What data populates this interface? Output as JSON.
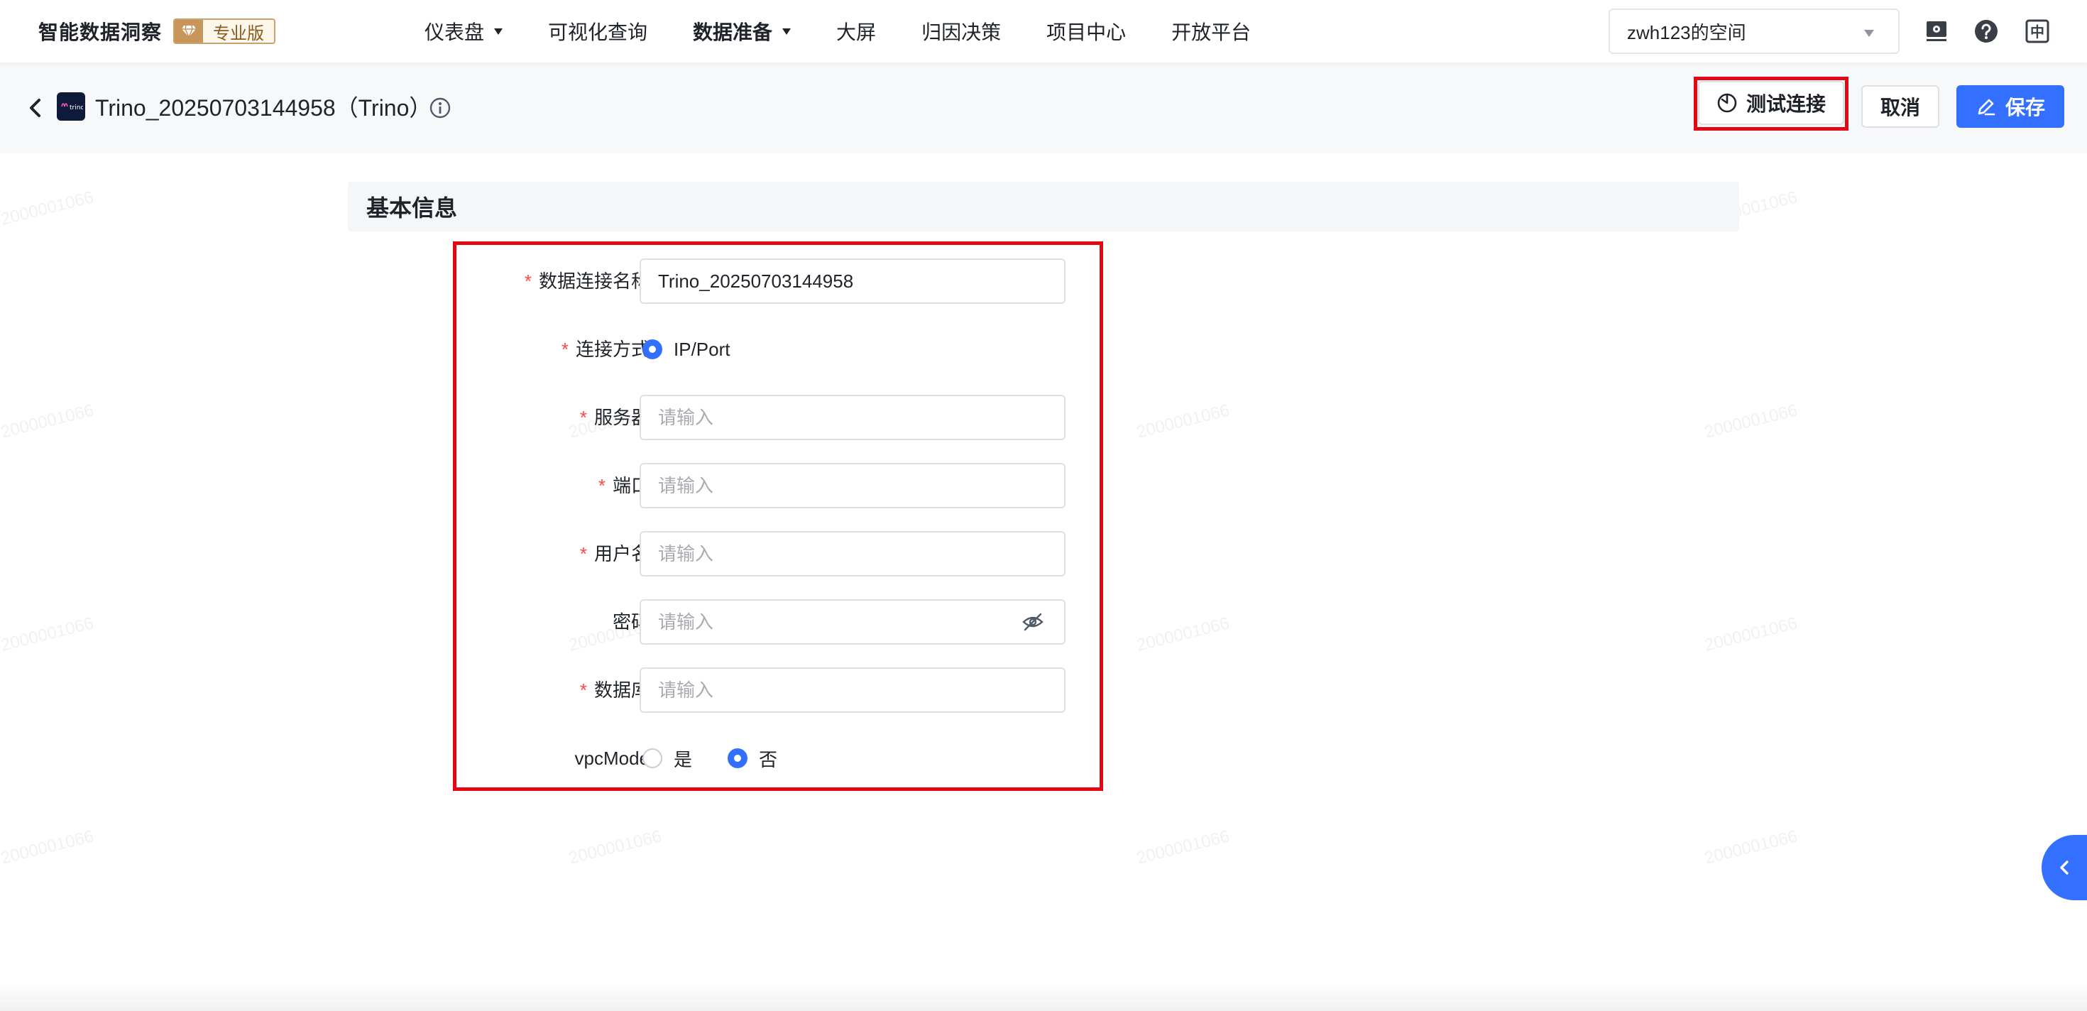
{
  "brand": {
    "title": "智能数据洞察",
    "badge": "专业版",
    "badge_icon": "diamond-icon"
  },
  "nav": {
    "items": [
      {
        "label": "仪表盘",
        "has_caret": true,
        "active": false
      },
      {
        "label": "可视化查询",
        "has_caret": false,
        "active": false
      },
      {
        "label": "数据准备",
        "has_caret": true,
        "active": true
      },
      {
        "label": "大屏",
        "has_caret": false,
        "active": false
      },
      {
        "label": "归因决策",
        "has_caret": false,
        "active": false
      },
      {
        "label": "项目中心",
        "has_caret": false,
        "active": false
      },
      {
        "label": "开放平台",
        "has_caret": false,
        "active": false
      }
    ]
  },
  "space_select": {
    "value": "zwh123的空间"
  },
  "header_icons": [
    "monitor-icon",
    "help-icon",
    "language-icon"
  ],
  "language_glyph": "中",
  "subheader": {
    "title": "Trino_20250703144958（Trino）",
    "logo_text": "trino",
    "test_label": "测试连接",
    "cancel_label": "取消",
    "save_label": "保存"
  },
  "section": {
    "title": "基本信息"
  },
  "form": {
    "name": {
      "label": "数据连接名称",
      "value": "Trino_20250703144958",
      "required": true
    },
    "conn_method": {
      "label": "连接方式",
      "option": "IP/Port",
      "required": true
    },
    "server": {
      "label": "服务器",
      "placeholder": "请输入",
      "required": true
    },
    "port": {
      "label": "端口",
      "placeholder": "请输入",
      "required": true
    },
    "username": {
      "label": "用户名",
      "placeholder": "请输入",
      "required": true
    },
    "password": {
      "label": "密码",
      "placeholder": "请输入",
      "required": false
    },
    "database": {
      "label": "数据库",
      "placeholder": "请输入",
      "required": true
    },
    "vpc": {
      "label": "vpcMode",
      "yes": "是",
      "no": "否",
      "selected": "否"
    }
  },
  "required_mark": "*",
  "watermark": "2000001066",
  "colors": {
    "primary": "#3370ff",
    "highlight": "#e30613",
    "required": "#f54a45"
  }
}
